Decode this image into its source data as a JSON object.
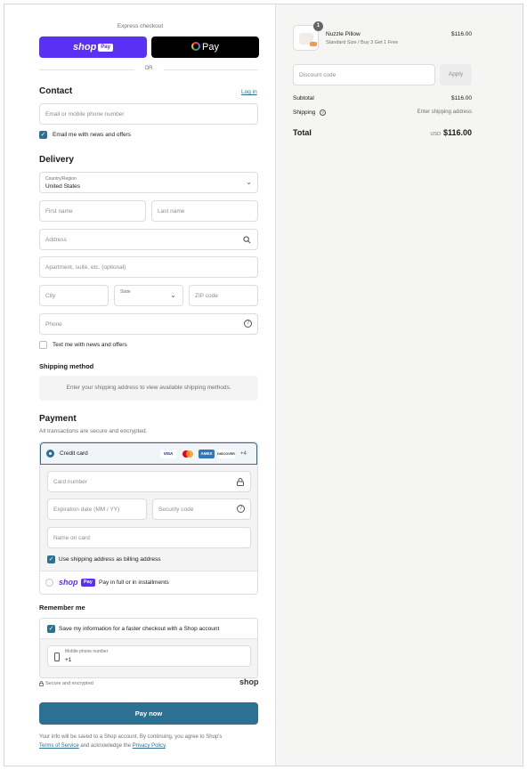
{
  "express": {
    "title": "Express checkout",
    "shop_pay_label": "shop",
    "shop_pay_badge": "Pay",
    "gpay_label": "Pay",
    "divider": "OR"
  },
  "contact": {
    "heading": "Contact",
    "login_link": "Log in",
    "email_placeholder": "Email or mobile phone number",
    "newsletter_label": "Email me with news and offers"
  },
  "delivery": {
    "heading": "Delivery",
    "country_label": "Country/Region",
    "country_value": "United States",
    "first_name_placeholder": "First name",
    "last_name_placeholder": "Last name",
    "address_placeholder": "Address",
    "apartment_placeholder": "Apartment, suite, etc. (optional)",
    "city_placeholder": "City",
    "state_placeholder": "State",
    "zip_placeholder": "ZIP code",
    "phone_placeholder": "Phone",
    "text_me_label": "Text me with news and offers"
  },
  "shipping": {
    "heading": "Shipping method",
    "notice": "Enter your shipping address to view available shipping methods."
  },
  "payment": {
    "heading": "Payment",
    "subheading": "All transactions are secure and encrypted.",
    "credit_card_label": "Credit card",
    "more_cards": "+4",
    "card_logos": [
      "VISA",
      "MC",
      "AMEX",
      "DISCOVER"
    ],
    "card_number_placeholder": "Card number",
    "expiration_placeholder": "Expiration date (MM / YY)",
    "security_code_placeholder": "Security code",
    "name_on_card_placeholder": "Name on card",
    "billing_same_label": "Use shipping address as billing address",
    "shop_pay_option_label": "Pay in full or in installments",
    "shop_pay_word": "shop",
    "shop_pay_badge": "Pay"
  },
  "remember": {
    "heading": "Remember me",
    "save_info_label": "Save my information for a faster checkout with a Shop account",
    "mobile_label": "Mobile phone number",
    "mobile_value": "+1",
    "secure_label": "Secure and encrypted",
    "shop_brand": "shop"
  },
  "pay_now_label": "Pay now",
  "legal": {
    "line1": "Your info will be saved to a Shop account. By continuing, you agree to Shop's",
    "terms_link": "Terms of Service",
    "and_text": "and acknowledge the",
    "privacy_link": "Privacy Policy",
    "period": "."
  },
  "summary": {
    "item_quantity": "1",
    "item_name": "Nuzzle Pillow",
    "item_variant": "Standard Size / Buy 3 Get 1 Free",
    "item_price": "$116.00",
    "discount_placeholder": "Discount code",
    "apply_label": "Apply",
    "subtotal_label": "Subtotal",
    "subtotal_value": "$116.00",
    "shipping_label": "Shipping",
    "shipping_value": "Enter shipping address",
    "total_label": "Total",
    "total_currency": "USD",
    "total_value": "$116.00"
  },
  "colors": {
    "shop_purple": "#5a31f4",
    "primary_button": "#2c7094",
    "link": "#2c7094"
  }
}
